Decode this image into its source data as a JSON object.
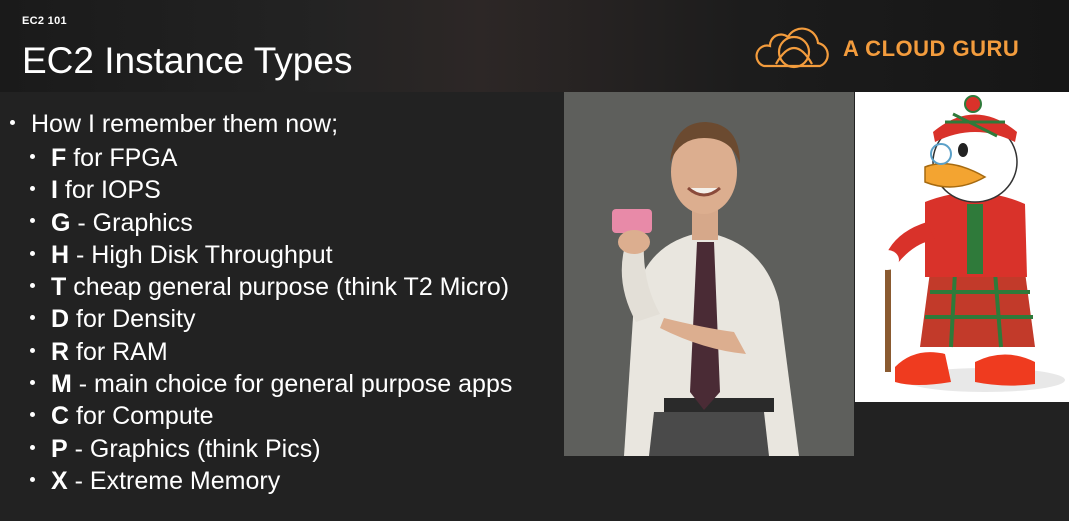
{
  "header": {
    "course_label": "EC2 101",
    "title": "EC2 Instance Types",
    "brand_name": "A CLOUD GURU",
    "brand_color": "#f39c3d",
    "logo_icon": "cloud-logo-icon"
  },
  "content": {
    "intro": "How I remember them now;",
    "items": [
      {
        "letter": "F",
        "text": " for FPGA"
      },
      {
        "letter": "I",
        "text": " for IOPS"
      },
      {
        "letter": "G",
        "text": " - Graphics"
      },
      {
        "letter": "H",
        "text": " - High Disk Throughput"
      },
      {
        "letter": "T",
        "text": " cheap general purpose (think T2 Micro)"
      },
      {
        "letter": "D",
        "text": " for Density"
      },
      {
        "letter": "R",
        "text": " for RAM"
      },
      {
        "letter": "M",
        "text": " - main choice for general purpose apps"
      },
      {
        "letter": "C",
        "text": " for Compute"
      },
      {
        "letter": "P",
        "text": " - Graphics (think Pics)"
      },
      {
        "letter": "X",
        "text": " - Extreme Memory"
      }
    ]
  },
  "images": {
    "person": "photo-of-man-holding-soap",
    "duck": "scrooge-mcduck-in-kilt-illustration"
  }
}
